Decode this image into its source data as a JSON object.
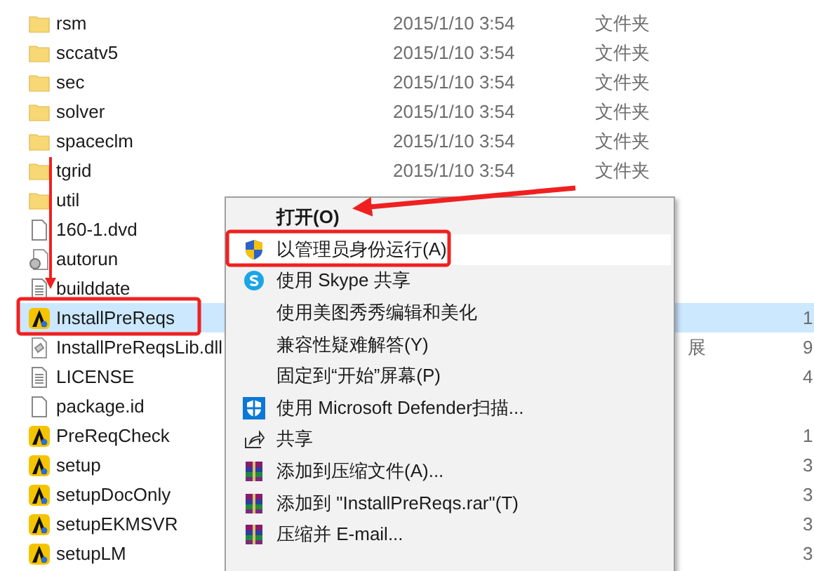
{
  "files": [
    {
      "name": "rsm",
      "kind": "folder",
      "date": "2015/1/10 3:54",
      "type": "文件夹",
      "selected": false
    },
    {
      "name": "sccatv5",
      "kind": "folder",
      "date": "2015/1/10 3:54",
      "type": "文件夹",
      "selected": false
    },
    {
      "name": "sec",
      "kind": "folder",
      "date": "2015/1/10 3:54",
      "type": "文件夹",
      "selected": false
    },
    {
      "name": "solver",
      "kind": "folder",
      "date": "2015/1/10 3:54",
      "type": "文件夹",
      "selected": false
    },
    {
      "name": "spaceclm",
      "kind": "folder",
      "date": "2015/1/10 3:54",
      "type": "文件夹",
      "selected": false
    },
    {
      "name": "tgrid",
      "kind": "folder",
      "date": "2015/1/10 3:54",
      "type": "文件夹",
      "selected": false
    },
    {
      "name": "util",
      "kind": "folder",
      "selected": false
    },
    {
      "name": "160-1.dvd",
      "kind": "blank",
      "selected": false
    },
    {
      "name": "autorun",
      "kind": "settings",
      "selected": false
    },
    {
      "name": "builddate",
      "kind": "text",
      "selected": false
    },
    {
      "name": "InstallPreReqs",
      "kind": "app",
      "size": "1",
      "selected": true
    },
    {
      "name": "InstallPreReqsLib.dll",
      "kind": "dll",
      "type": "展",
      "size": "9",
      "selected": false
    },
    {
      "name": "LICENSE",
      "kind": "text",
      "size": "4",
      "selected": false
    },
    {
      "name": "package.id",
      "kind": "blank",
      "selected": false
    },
    {
      "name": "PreReqCheck",
      "kind": "app",
      "size": "1",
      "selected": false
    },
    {
      "name": "setup",
      "kind": "app",
      "size": "3",
      "selected": false
    },
    {
      "name": "setupDocOnly",
      "kind": "app",
      "size": "3",
      "selected": false
    },
    {
      "name": "setupEKMSVR",
      "kind": "app",
      "size": "3",
      "selected": false
    },
    {
      "name": "setupLM",
      "kind": "app",
      "size": "3",
      "selected": false
    }
  ],
  "context_menu": [
    {
      "label": "打开(O)",
      "kind": "plain",
      "bold": true,
      "highlighted": false
    },
    {
      "label": "以管理员身份运行(A)",
      "kind": "uac",
      "bold": false,
      "highlighted": true
    },
    {
      "label": "使用 Skype 共享",
      "kind": "skype",
      "bold": false,
      "highlighted": false
    },
    {
      "label": "使用美图秀秀编辑和美化",
      "kind": "plain",
      "bold": false,
      "highlighted": false
    },
    {
      "label": "兼容性疑难解答(Y)",
      "kind": "plain",
      "bold": false,
      "highlighted": false
    },
    {
      "label": "固定到“开始”屏幕(P)",
      "kind": "plain",
      "bold": false,
      "highlighted": false
    },
    {
      "label": "使用 Microsoft Defender扫描...",
      "kind": "defender",
      "bold": false,
      "highlighted": false
    },
    {
      "label": "共享",
      "kind": "share",
      "bold": false,
      "highlighted": false
    },
    {
      "label": "添加到压缩文件(A)...",
      "kind": "archive",
      "bold": false,
      "highlighted": false
    },
    {
      "label": "添加到 \"InstallPreReqs.rar\"(T)",
      "kind": "archive",
      "bold": false,
      "highlighted": false
    },
    {
      "label": "压缩并 E-mail...",
      "kind": "archive",
      "bold": false,
      "highlighted": false
    }
  ]
}
